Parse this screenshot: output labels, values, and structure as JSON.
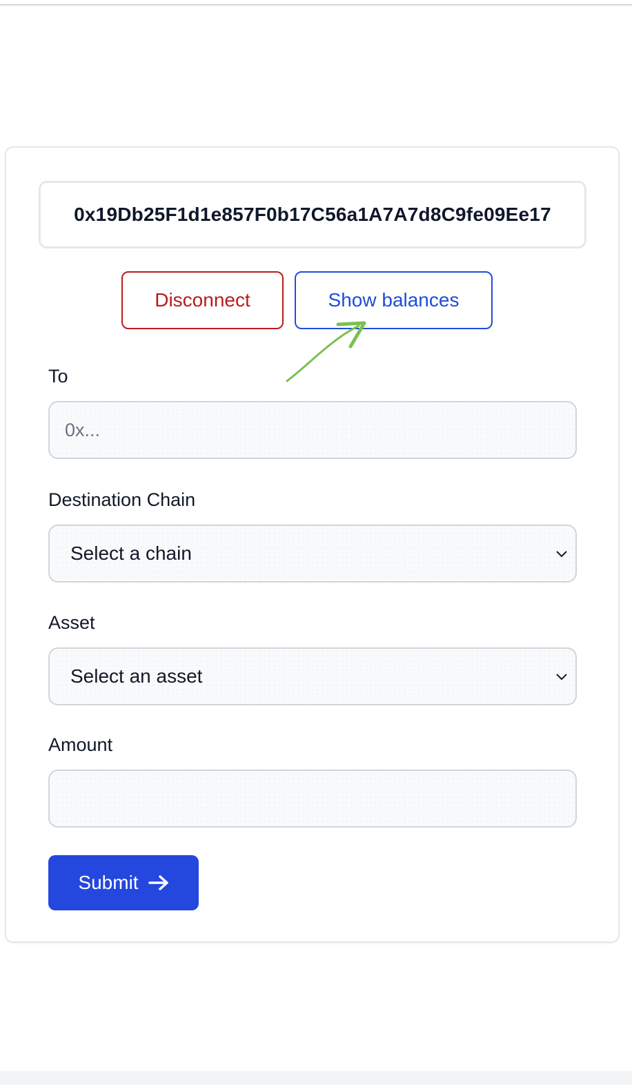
{
  "wallet": {
    "address": "0x19Db25F1d1e857F0b17C56a1A7A7d8C9fe09Ee17"
  },
  "actions": {
    "disconnect_label": "Disconnect",
    "show_balances_label": "Show balances"
  },
  "form": {
    "to": {
      "label": "To",
      "placeholder": "0x...",
      "value": ""
    },
    "destination_chain": {
      "label": "Destination Chain",
      "selected": "Select a chain"
    },
    "asset": {
      "label": "Asset",
      "selected": "Select an asset"
    },
    "amount": {
      "label": "Amount",
      "value": ""
    },
    "submit_label": "Submit"
  },
  "icons": {
    "annotation": "curved-arrow-icon",
    "select_chevron": "chevron-down-icon",
    "submit": "arrow-right-icon"
  },
  "colors": {
    "danger": "#b91c1c",
    "primary": "#1d4ed8",
    "submit_bg": "#2447de",
    "annotation": "#7cc052"
  }
}
